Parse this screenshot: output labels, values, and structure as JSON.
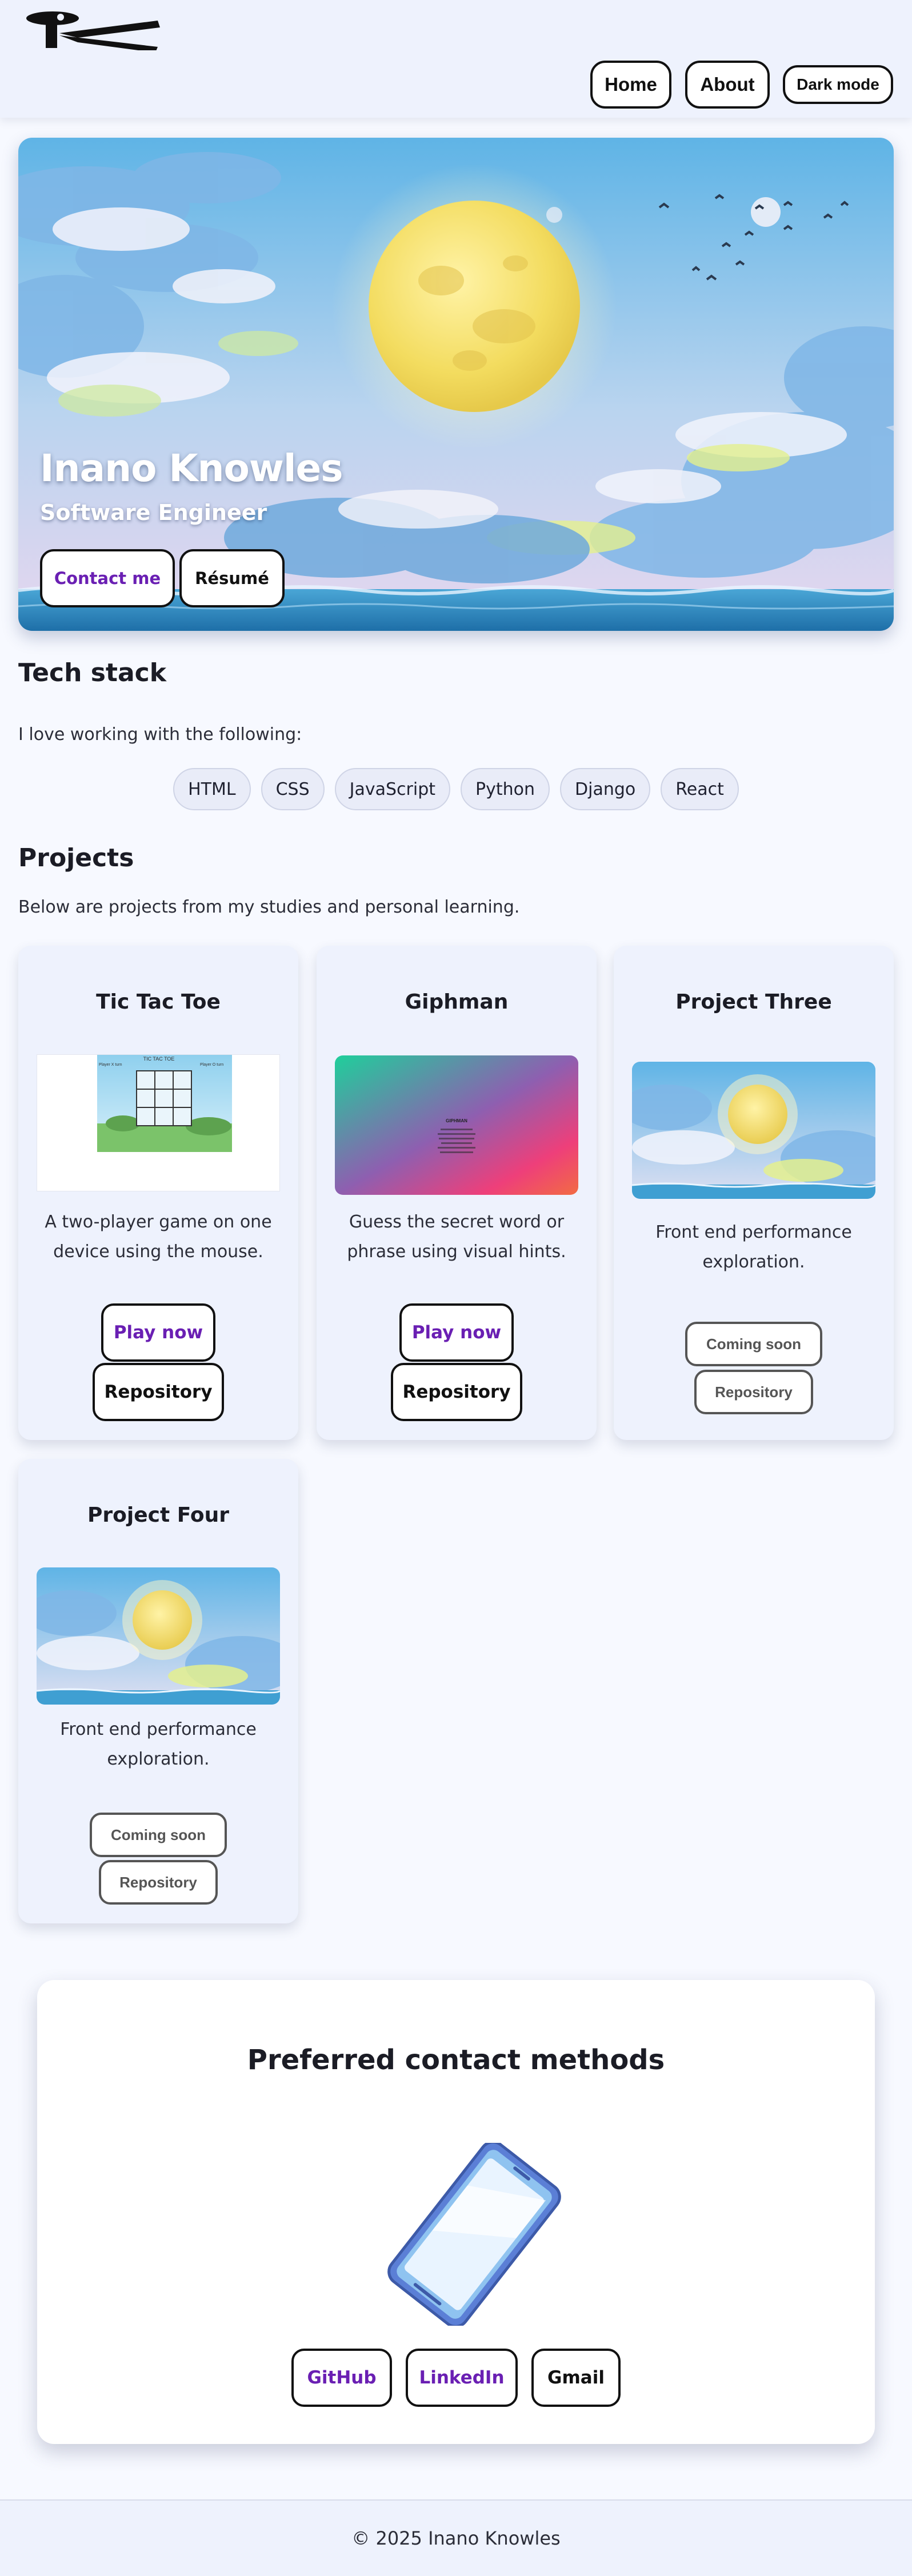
{
  "header": {
    "nav": {
      "home": "Home",
      "about": "About",
      "dark_mode": "Dark mode"
    }
  },
  "hero": {
    "name": "Inano Knowles",
    "role": "Software Engineer",
    "contact_label": "Contact me",
    "resume_label": "Résumé"
  },
  "tech": {
    "heading": "Tech stack",
    "intro": "I love working with the following:",
    "items": [
      "HTML",
      "CSS",
      "JavaScript",
      "Python",
      "Django",
      "React"
    ]
  },
  "projects": {
    "heading": "Projects",
    "intro": "Below are projects from my studies and personal learning.",
    "cards": [
      {
        "title": "Tic Tac Toe",
        "description": "A two-player game on one device using the mouse.",
        "play_label": "Play now",
        "repo_label": "Repository",
        "preview_title": "TIC TAC TOE",
        "preview_left": "Player X turn",
        "preview_right": "Player O turn"
      },
      {
        "title": "Giphman",
        "description": "Guess the secret word or phrase using visual hints.",
        "play_label": "Play now",
        "repo_label": "Repository",
        "preview_title": "GIPHMAN"
      },
      {
        "title": "Project Three",
        "description": "Front end performance exploration.",
        "soon_label": "Coming soon",
        "repo_label": "Repository"
      },
      {
        "title": "Project Four",
        "description": "Front end performance exploration.",
        "soon_label": "Coming soon",
        "repo_label": "Repository"
      }
    ]
  },
  "contact": {
    "heading": "Preferred contact methods",
    "github": "GitHub",
    "linkedin": "LinkedIn",
    "gmail": "Gmail"
  },
  "footer": {
    "text": "© 2025 Inano Knowles"
  },
  "colors": {
    "accent_purple": "#6a1fb3",
    "page_bg": "#f7f9ff",
    "header_bg": "#eef2fd"
  }
}
